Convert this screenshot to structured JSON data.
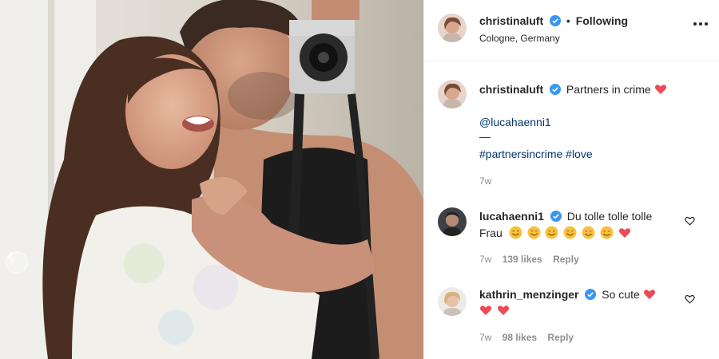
{
  "header": {
    "username": "christinaluft",
    "follow_status": "Following",
    "dot": "•",
    "location": "Cologne, Germany"
  },
  "caption": {
    "username": "christinaluft",
    "text": "Partners in crime",
    "mention": "@lucahaenni1",
    "separator": "—",
    "hashtags": "#partnersincrime #love",
    "time": "7w"
  },
  "comments": [
    {
      "username": "lucahaenni1",
      "text": "Du tolle tolle tolle",
      "text2": "Frau",
      "time": "7w",
      "likes": "139 likes",
      "reply": "Reply"
    },
    {
      "username": "kathrin_menzinger",
      "text": "So cute",
      "time": "7w",
      "likes": "98 likes",
      "reply": "Reply"
    }
  ],
  "colors": {
    "verified_blue": "#3897f0",
    "heart_red": "#ed4956",
    "link_blue": "#00376b",
    "muted": "#8e8e8e"
  },
  "icons": [
    "verified-badge-icon",
    "more-options-icon",
    "heart-outline-icon",
    "red-heart-emoji-icon",
    "smiling-face-emoji-icon",
    "chevron-left-icon",
    "camera"
  ]
}
